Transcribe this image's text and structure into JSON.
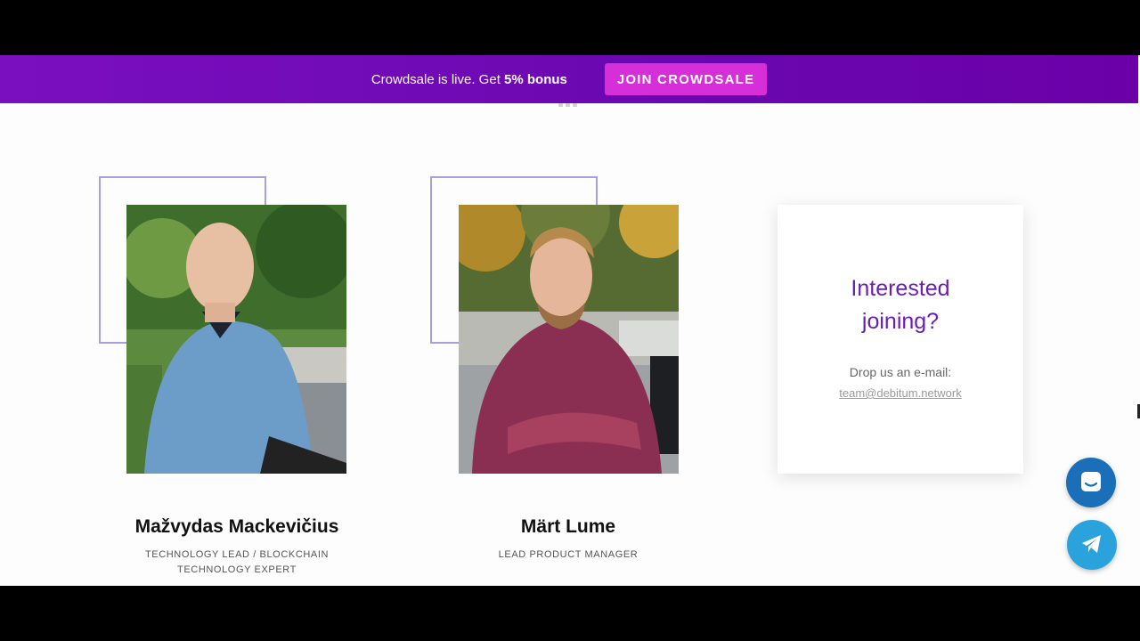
{
  "banner": {
    "text_prefix": "Crowdsale is live. Get ",
    "text_bold": "5% bonus",
    "button_label": "JOIN CROWDSALE",
    "accent_color": "#d62fd8"
  },
  "team": [
    {
      "name": "Mažvydas Mackevičius",
      "role_line1": "TECHNOLOGY LEAD / BLOCKCHAIN",
      "role_line2": "TECHNOLOGY EXPERT"
    },
    {
      "name": "Märt Lume",
      "role_line1": "LEAD PRODUCT MANAGER",
      "role_line2": ""
    }
  ],
  "join_card": {
    "title_line1": "Interested",
    "title_line2": "joining?",
    "drop_text": "Drop us an e-mail:",
    "email": "team@debitum.network"
  },
  "floating": {
    "chat_icon": "chat-icon",
    "telegram_icon": "telegram-icon"
  }
}
